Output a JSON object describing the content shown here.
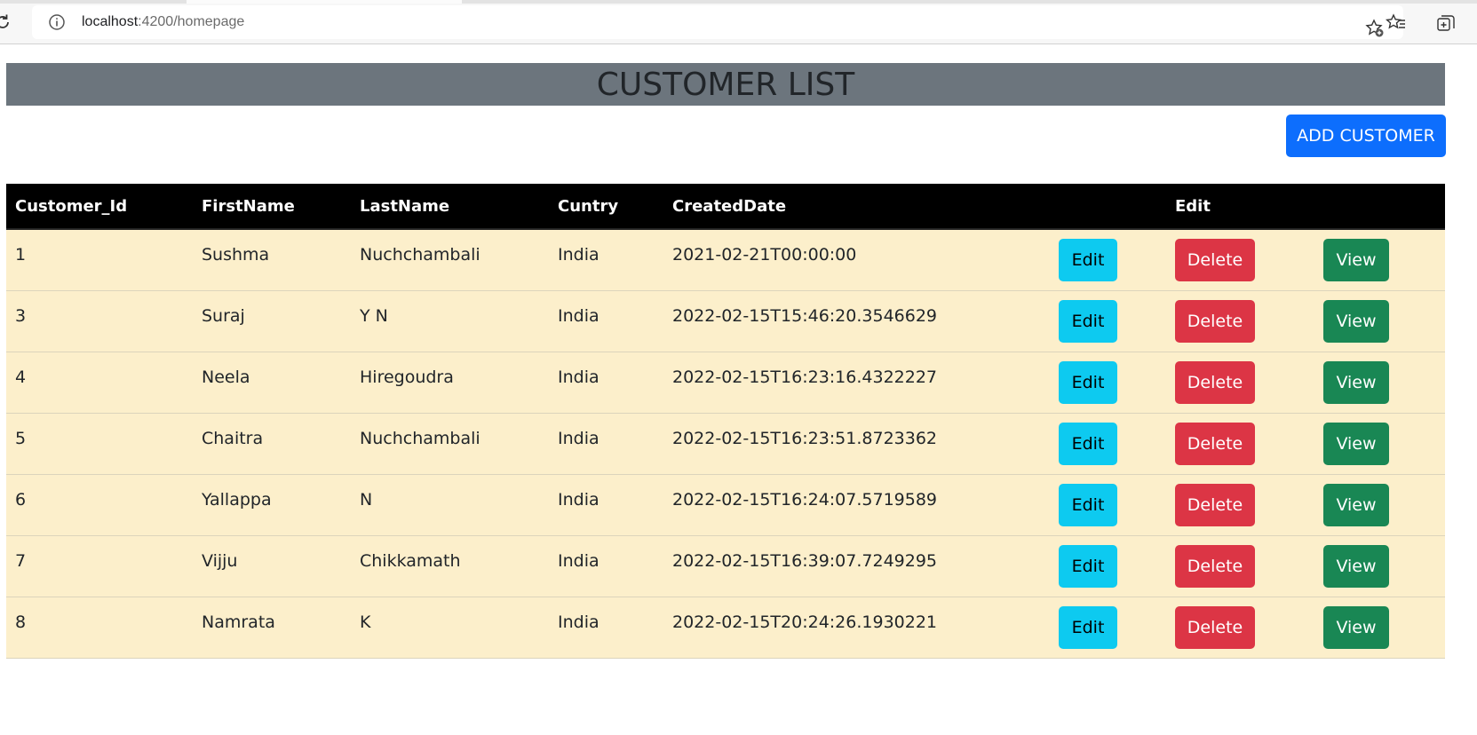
{
  "browser": {
    "url_host": "localhost",
    "url_path": ":4200/homepage"
  },
  "header": {
    "title": "CUSTOMER LIST"
  },
  "actions": {
    "add_customer_label": "ADD CUSTOMER"
  },
  "table": {
    "columns": [
      "Customer_Id",
      "FirstName",
      "LastName",
      "Cuntry",
      "CreatedDate",
      "",
      "Edit",
      ""
    ],
    "rows": [
      {
        "id": "1",
        "first": "Sushma",
        "last": "Nuchchambali",
        "country": "India",
        "created": "2021-02-21T00:00:00"
      },
      {
        "id": "3",
        "first": "Suraj",
        "last": "Y N",
        "country": "India",
        "created": "2022-02-15T15:46:20.3546629"
      },
      {
        "id": "4",
        "first": "Neela",
        "last": "Hiregoudra",
        "country": "India",
        "created": "2022-02-15T16:23:16.4322227"
      },
      {
        "id": "5",
        "first": "Chaitra",
        "last": "Nuchchambali",
        "country": "India",
        "created": "2022-02-15T16:23:51.8723362"
      },
      {
        "id": "6",
        "first": "Yallappa",
        "last": "N",
        "country": "India",
        "created": "2022-02-15T16:24:07.5719589"
      },
      {
        "id": "7",
        "first": "Vijju",
        "last": "Chikkamath",
        "country": "India",
        "created": "2022-02-15T16:39:07.7249295"
      },
      {
        "id": "8",
        "first": "Namrata",
        "last": "K",
        "country": "India",
        "created": "2022-02-15T20:24:26.1930221"
      }
    ],
    "row_buttons": {
      "edit_label": "Edit",
      "delete_label": "Delete",
      "view_label": "View"
    }
  },
  "colors": {
    "header_bg": "#6c757d",
    "add_button": "#0d6efd",
    "table_head": "#000000",
    "row_bg": "#fcefcb",
    "edit_button": "#0dcaf0",
    "delete_button": "#dc3545",
    "view_button": "#198754"
  },
  "icons": [
    "reload-icon",
    "info-icon",
    "add-favorite-icon",
    "favorites-icon",
    "collections-icon"
  ]
}
